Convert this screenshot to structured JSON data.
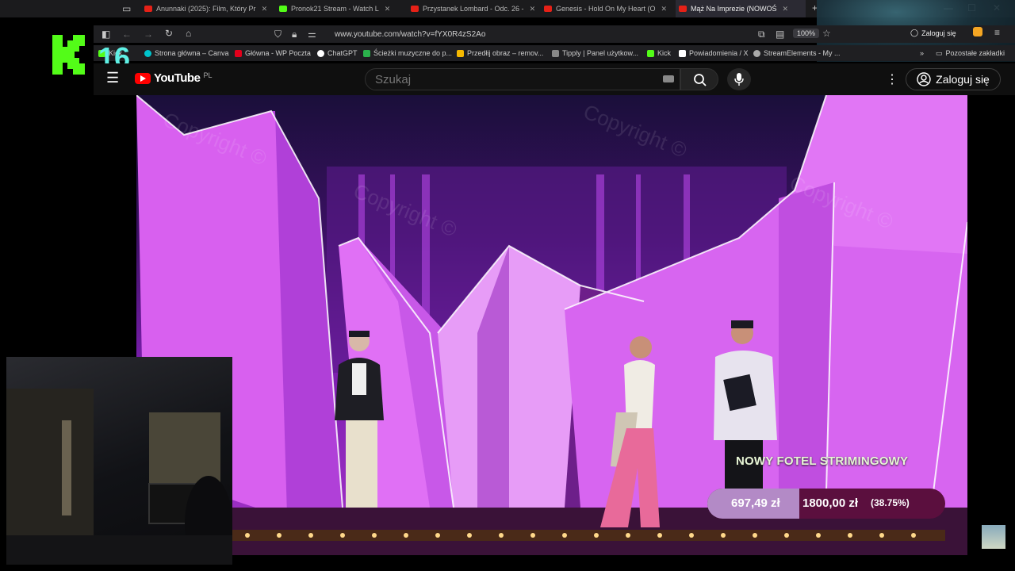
{
  "browser": {
    "tabs": [
      {
        "title": "Anunnaki (2025): Film, Który Pr",
        "favicon_color": "#e62117"
      },
      {
        "title": "Pronok21 Stream - Watch L",
        "favicon_color": "#53fc18"
      },
      {
        "title": "Przystanek Lombard - Odc. 26 -",
        "favicon_color": "#e62117"
      },
      {
        "title": "Genesis - Hold On My Heart (O",
        "favicon_color": "#e62117"
      },
      {
        "title": "Mąż Na Imprezie (NOWOŚ",
        "favicon_color": "#e62117"
      }
    ],
    "new_tab": "+",
    "url": "www.youtube.com/watch?v=fYX0R4zS2Ao",
    "zoom": "100%",
    "login": "Zaloguj się",
    "bookmarks": [
      {
        "label": "Kick",
        "color": "#53fc18"
      },
      {
        "label": "Strona główna – Canva",
        "color": "#00c4cc"
      },
      {
        "label": "Główna - WP Poczta",
        "color": "#e3001b"
      },
      {
        "label": "ChatGPT",
        "color": "#ffffff"
      },
      {
        "label": "Ścieżki muzyczne do p...",
        "color": "#2bb24c"
      },
      {
        "label": "Przedłij obraz – remov...",
        "color": "#f5b800"
      },
      {
        "label": "Tipply | Panel użytkow...",
        "color": "#888888"
      },
      {
        "label": "Kick",
        "color": "#53fc18"
      },
      {
        "label": "Powiadomienia / X",
        "color": "#ffffff"
      },
      {
        "label": "StreamElements - My ...",
        "color": "#aaaaaa"
      }
    ],
    "other_bookmarks": "Pozostałe zakładki"
  },
  "youtube": {
    "logo": "YouTube",
    "country": "PL",
    "search_placeholder": "Szukaj",
    "login": "Zaloguj się"
  },
  "overlay": {
    "badge": "16",
    "goal_title": "NOWY FOTEL STRIMINGOWY",
    "goal_current": "697,49 zł",
    "goal_target": "1800,00 zł",
    "goal_percent": "(38.75%)",
    "goal_fraction": 0.3875
  },
  "watermark": "Copyright ©"
}
